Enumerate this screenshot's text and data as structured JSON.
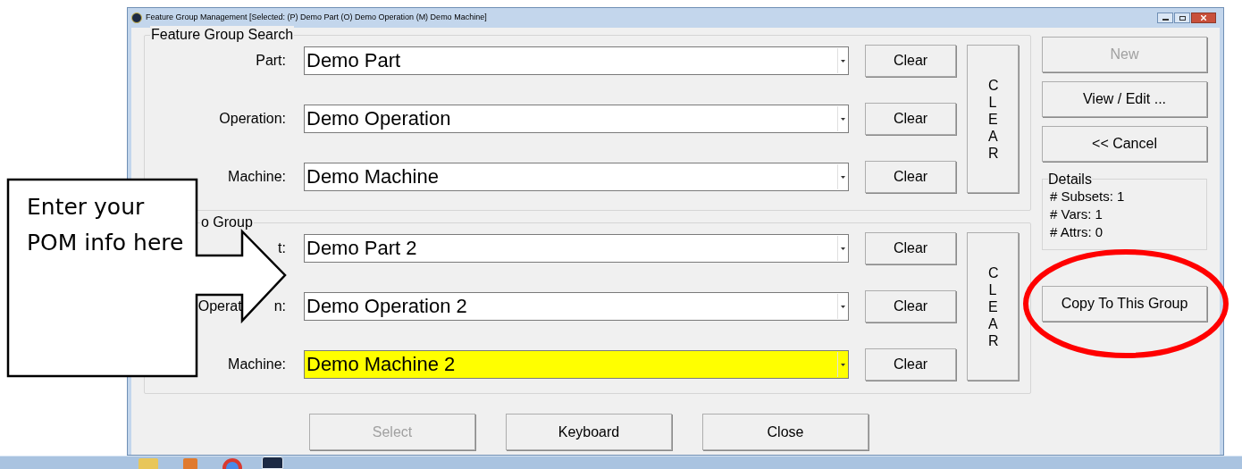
{
  "window": {
    "title": "Feature Group Management [Selected: (P) Demo Part (O) Demo Operation (M) Demo Machine]"
  },
  "search_group": {
    "title": "Feature Group Search",
    "clear_all": "CLEAR",
    "rows": [
      {
        "label": [
          "Part:"
        ],
        "value": "Demo Part",
        "highlighted": false,
        "clear": "Clear"
      },
      {
        "label": [
          "Operation:"
        ],
        "value": "Demo Operation",
        "highlighted": false,
        "clear": "Clear"
      },
      {
        "label": [
          "Machine:"
        ],
        "value": "Demo Machine",
        "highlighted": false,
        "clear": "Clear"
      }
    ]
  },
  "copy_group": {
    "title": "o Group",
    "clear_all": "CLEAR",
    "rows": [
      {
        "label": [
          "t:"
        ],
        "value": "Demo Part 2",
        "highlighted": false,
        "clear": "Clear"
      },
      {
        "label": [
          "Operat",
          "n:"
        ],
        "value": "Demo Operation 2",
        "highlighted": false,
        "clear": "Clear"
      },
      {
        "label": [
          "Machine:"
        ],
        "value": "Demo Machine 2",
        "highlighted": true,
        "clear": "Clear"
      }
    ]
  },
  "side_buttons": [
    {
      "label": "New",
      "disabled": true
    },
    {
      "label": "View / Edit ...",
      "disabled": false
    },
    {
      "label": "<< Cancel",
      "disabled": false
    }
  ],
  "details": {
    "title": "Details",
    "lines": [
      "# Subsets: 1",
      "# Vars: 1",
      "# Attrs: 0"
    ]
  },
  "copy_button": {
    "label": "Copy To This Group",
    "disabled": false
  },
  "bottom_buttons": [
    {
      "label": "Select",
      "disabled": true
    },
    {
      "label": "Keyboard",
      "disabled": false
    },
    {
      "label": "Close",
      "disabled": false
    }
  ],
  "callout": {
    "text": "Enter your POM info here"
  }
}
